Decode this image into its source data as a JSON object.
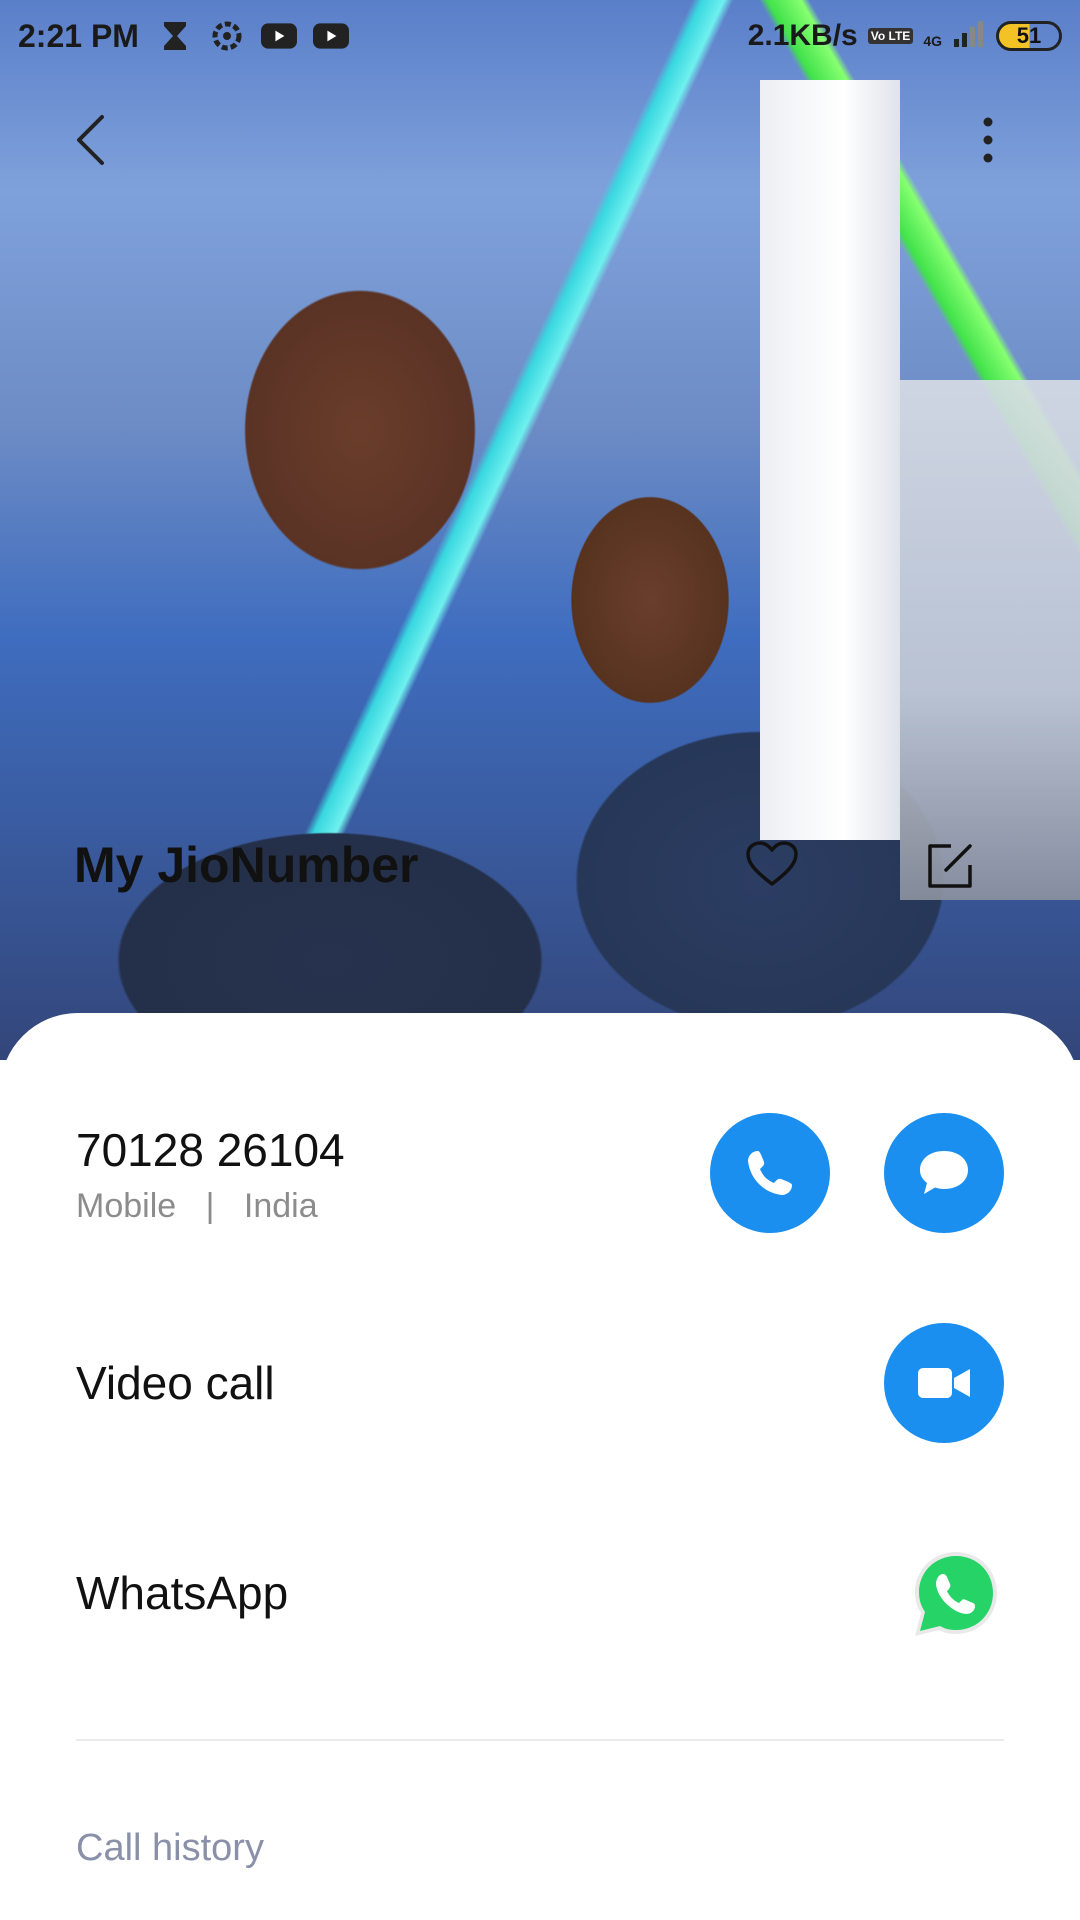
{
  "status_bar": {
    "time": "2:21 PM",
    "speed": "2.1KB/s",
    "volte": "Vo LTE",
    "network": "4G",
    "battery": "51"
  },
  "contact": {
    "name": "My JioNumber",
    "number": "70128 26104",
    "type": "Mobile",
    "separator": "|",
    "country": "India"
  },
  "rows": {
    "video_call": "Video call",
    "whatsapp": "WhatsApp",
    "call_history": "Call history"
  },
  "colors": {
    "accent": "#1a8ff0",
    "whatsapp": "#25d366"
  },
  "icons": {
    "back": "chevron-left-icon",
    "more": "more-vertical-icon",
    "favorite": "heart-outline-icon",
    "edit": "edit-icon",
    "call": "phone-icon",
    "message": "chat-bubble-icon",
    "video": "video-camera-icon",
    "whatsapp": "whatsapp-icon"
  }
}
